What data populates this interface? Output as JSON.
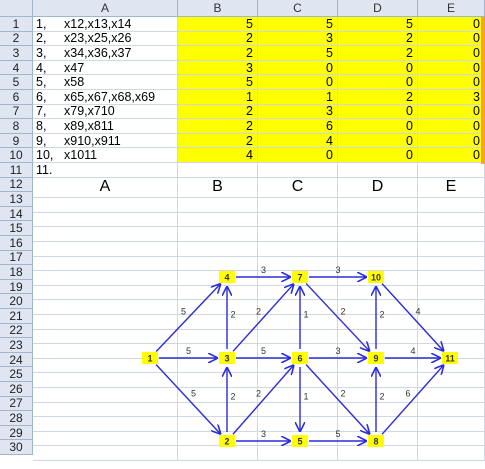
{
  "columns": [
    "A",
    "B",
    "C",
    "D",
    "E"
  ],
  "row_numbers": [
    "1",
    "2",
    "3",
    "4",
    "5",
    "6",
    "7",
    "8",
    "9",
    "10",
    "11",
    "12",
    "13",
    "14",
    "15",
    "16",
    "17",
    "18",
    "19",
    "20",
    "21",
    "22",
    "23",
    "24",
    "25",
    "26",
    "27",
    "28",
    "29",
    "30"
  ],
  "rows": [
    {
      "idx": "1,",
      "label": "x12,x13,x14",
      "b": "5",
      "c": "5",
      "d": "5",
      "e": "0"
    },
    {
      "idx": "2,",
      "label": "x23,x25,x26",
      "b": "2",
      "c": "3",
      "d": "2",
      "e": "0"
    },
    {
      "idx": "3,",
      "label": "x34,x36,x37",
      "b": "2",
      "c": "5",
      "d": "2",
      "e": "0"
    },
    {
      "idx": "4,",
      "label": "x47",
      "b": "3",
      "c": "0",
      "d": "0",
      "e": "0"
    },
    {
      "idx": "5,",
      "label": "x58",
      "b": "5",
      "c": "0",
      "d": "0",
      "e": "0"
    },
    {
      "idx": "6,",
      "label": "x65,x67,x68,x69",
      "b": "1",
      "c": "1",
      "d": "2",
      "e": "3"
    },
    {
      "idx": "7,",
      "label": "x79,x710",
      "b": "2",
      "c": "3",
      "d": "0",
      "e": "0"
    },
    {
      "idx": "8,",
      "label": "x89,x811",
      "b": "2",
      "c": "6",
      "d": "0",
      "e": "0"
    },
    {
      "idx": "9,",
      "label": "x910,x911",
      "b": "2",
      "c": "4",
      "d": "0",
      "e": "0"
    },
    {
      "idx": "10,",
      "label": "x1011",
      "b": "4",
      "c": "0",
      "d": "0",
      "e": "0"
    },
    {
      "idx": "11.",
      "label": "",
      "b": "",
      "c": "",
      "d": "",
      "e": ""
    }
  ],
  "row12": [
    "A",
    "B",
    "C",
    "D",
    "E"
  ],
  "graph": {
    "nodes": [
      "1",
      "2",
      "3",
      "4",
      "5",
      "6",
      "7",
      "8",
      "9",
      "10",
      "11"
    ],
    "edges": [
      {
        "from": "1",
        "to": "4",
        "w": "5"
      },
      {
        "from": "1",
        "to": "3",
        "w": "5"
      },
      {
        "from": "1",
        "to": "2",
        "w": "5"
      },
      {
        "from": "4",
        "to": "7",
        "w": "3"
      },
      {
        "from": "3",
        "to": "4",
        "w": "2"
      },
      {
        "from": "2",
        "to": "3",
        "w": "2"
      },
      {
        "from": "3",
        "to": "7",
        "w": "2"
      },
      {
        "from": "3",
        "to": "6",
        "w": "5"
      },
      {
        "from": "2",
        "to": "6",
        "w": "2"
      },
      {
        "from": "2",
        "to": "5",
        "w": "3"
      },
      {
        "from": "6",
        "to": "7",
        "w": "1"
      },
      {
        "from": "6",
        "to": "5",
        "w": "1"
      },
      {
        "from": "6",
        "to": "9",
        "w": "3"
      },
      {
        "from": "6",
        "to": "8",
        "w": "2"
      },
      {
        "from": "7",
        "to": "9",
        "w": "2"
      },
      {
        "from": "7",
        "to": "10",
        "w": "3"
      },
      {
        "from": "5",
        "to": "8",
        "w": "5"
      },
      {
        "from": "9",
        "to": "10",
        "w": "2"
      },
      {
        "from": "8",
        "to": "9",
        "w": "2"
      },
      {
        "from": "9",
        "to": "11",
        "w": "4"
      },
      {
        "from": "10",
        "to": "11",
        "w": "4"
      },
      {
        "from": "8",
        "to": "11",
        "w": "6"
      }
    ]
  },
  "colors": {
    "header_bg": "#dfe6f1",
    "highlight": "#ffff00",
    "edge": "#2b2bd9",
    "accent": "#f5a623"
  }
}
